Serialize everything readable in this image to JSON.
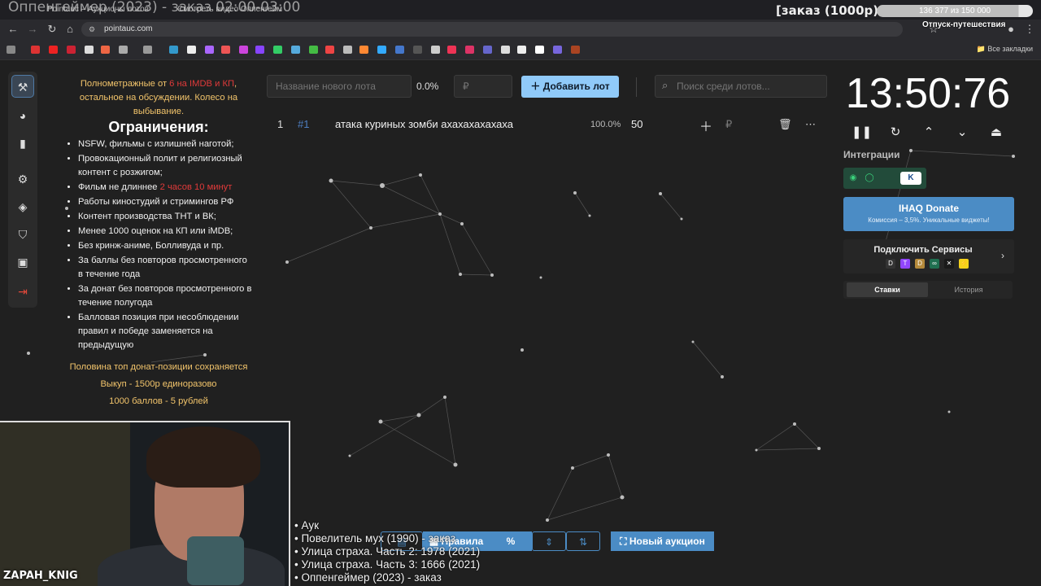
{
  "browser": {
    "tabs": [
      "Pointauc – Аукционы лотов",
      "Смотреть видео Оппенгейм"
    ],
    "url": "pointauc.com",
    "all_bookmarks_label": "Все закладки"
  },
  "stream_overlay": {
    "title": "Оппенгеймер (2023) - заказ 02:00-03:00",
    "order_label": "[заказ (1000р)",
    "goal_progress": "136 377  из 150 000",
    "goal_fraction": 0.909,
    "goal_sub": "Отпуск-путешествия",
    "streamer_name": "ZAPAH_KNIG"
  },
  "rules": {
    "intro_before": "Полнометражные от ",
    "intro_red": "6 на IMDB и КП",
    "intro_after": ", остальное на обсуждении. Колесо на выбывание.",
    "heading": "Ограничения:",
    "items": [
      "NSFW, фильмы с излишней наготой;",
      "Провокационный полит и религиозный контент с розжигом;",
      "Работы киностудий и стримингов РФ",
      "Контент производства ТНТ и ВК;",
      "Менее 1000 оценок на КП или iMDB;",
      "Без кринж-аниме, Болливуда и пр.",
      "За баллы без повторов просмотренного в течение года",
      "За донат без повторов просмотренного в течение полугода",
      "Балловая позиция при несоблюдении правил и победе заменяется на предыдущую"
    ],
    "length_before": "Фильм не длиннее ",
    "length_red": "2 часов 10 минут",
    "footer": [
      "Половина топ донат-позиции сохраняется",
      "Выкуп - 1500р единоразово",
      "1000 баллов - 5 рублей"
    ]
  },
  "toolbar": {
    "lot_name_placeholder": "Название нового лота",
    "percent_label": "0.0%",
    "amount_placeholder": "₽",
    "add_lot_label": "Добавить лот",
    "search_placeholder": "Поиск среди лотов..."
  },
  "lots": [
    {
      "index": "1",
      "id": "#1",
      "name": "атака куриных зомби ахахахахахаха",
      "percent": "100.0%",
      "amount": "50",
      "currency": "₽"
    }
  ],
  "timer": {
    "display": "13:50:76"
  },
  "integrations": {
    "title": "Интеграции",
    "donate_title": "IHAQ Donate",
    "donate_sub": "Комиссия – 3,5%. Уникальные виджеты!",
    "services_title": "Подключить Сервисы",
    "tab_bets": "Ставки",
    "tab_history": "История"
  },
  "bottom_bar": {
    "rules_label": "Правила",
    "new_auction_label": "Новый аукцион"
  },
  "order_list": [
    "• Аук",
    "• Повелитель мух (1990) - заказ",
    "• Улица страха. Часть 2: 1978 (2021)",
    "• Улица страха. Часть 3: 1666 (2021)",
    "• Оппенгеймер (2023) - заказ"
  ],
  "colors": {
    "accent": "#90caf9",
    "accent_dark": "#4b8cc5",
    "warning_text": "#f2c46b",
    "danger_text": "#e03a3a",
    "integration_bg": "#224b3a"
  }
}
